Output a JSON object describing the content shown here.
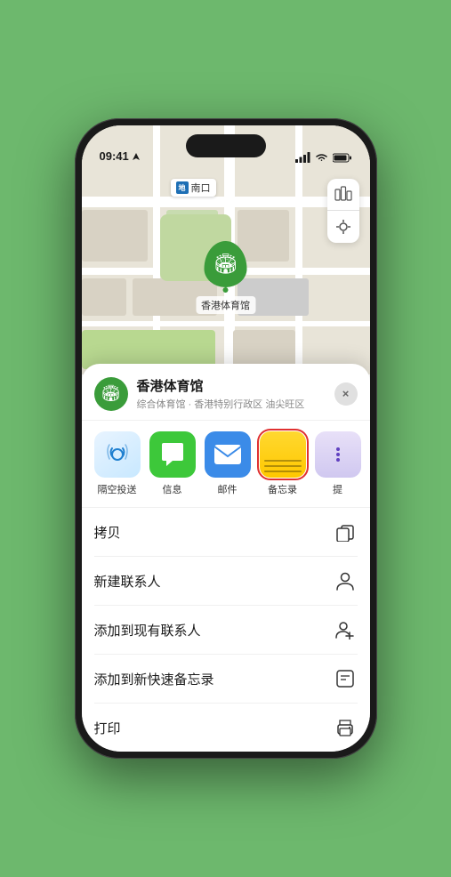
{
  "status_bar": {
    "time": "09:41",
    "location_arrow": "▶",
    "signal": "signal",
    "wifi": "wifi",
    "battery": "battery"
  },
  "map": {
    "label_text": "南口",
    "stadium_name": "香港体育馆",
    "controls": [
      {
        "icon": "🗺",
        "name": "map-type-button"
      },
      {
        "icon": "↖",
        "name": "location-button"
      }
    ]
  },
  "venue_card": {
    "name": "香港体育馆",
    "subtitle": "综合体育馆 · 香港特别行政区 油尖旺区",
    "close_label": "×"
  },
  "share_row": [
    {
      "id": "airdrop",
      "label": "隔空投送",
      "type": "airdrop"
    },
    {
      "id": "messages",
      "label": "信息",
      "type": "messages"
    },
    {
      "id": "mail",
      "label": "邮件",
      "type": "mail"
    },
    {
      "id": "notes",
      "label": "备忘录",
      "type": "notes",
      "selected": true
    },
    {
      "id": "more",
      "label": "提",
      "type": "more"
    }
  ],
  "actions": [
    {
      "label": "拷贝",
      "icon": "copy",
      "unicode": "⎘"
    },
    {
      "label": "新建联系人",
      "icon": "person",
      "unicode": "👤"
    },
    {
      "label": "添加到现有联系人",
      "icon": "person-add",
      "unicode": "➕"
    },
    {
      "label": "添加到新快速备忘录",
      "icon": "notes-add",
      "unicode": "🖊"
    },
    {
      "label": "打印",
      "icon": "print",
      "unicode": "🖨"
    }
  ]
}
